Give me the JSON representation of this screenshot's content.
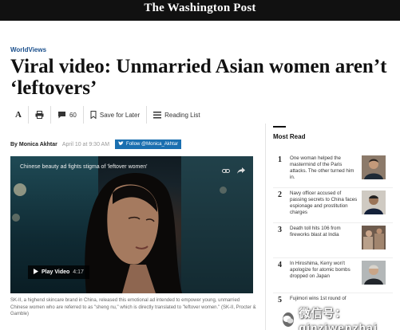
{
  "header": {
    "masthead": "The Washington Post",
    "bar_color": "#111111"
  },
  "article": {
    "section": "WorldViews",
    "headline": "Viral video: Unmarried Asian women aren’t ‘leftovers’",
    "toolbar": {
      "font_label": "A",
      "comments_count": "60",
      "save_label": "Save for Later",
      "reading_list_label": "Reading List"
    },
    "byline": {
      "author": "By Monica Akhtar",
      "date": "April 10 at 9:30 AM",
      "follow_label": "Follow @Monica_Akhtar",
      "follow_color": "#1a6fb0"
    },
    "video": {
      "title": "Chinese beauty ad fights stigma of 'leftover women'",
      "play_label": "Play Video",
      "duration": "4:17"
    },
    "caption": "SK-II, a highend skincare brand in China, released this emotional ad intended to empower young, unmarried Chinese women who are referred to as \"sheng nu,\" which is directly translated to \"leftover women.\" (SK-II, Procter & Gamble)"
  },
  "most_read": {
    "title": "Most Read",
    "items": [
      {
        "number": "1",
        "text": "One woman helped the mastermind of the Paris attacks. The other turned him in."
      },
      {
        "number": "2",
        "text": "Navy officer accused of passing secrets to China faces espionage and prostitution charges"
      },
      {
        "number": "3",
        "text": "Death toll hits 106 from fireworks blast at India"
      },
      {
        "number": "4",
        "text": "In Hiroshima, Kerry won't apologize for atomic bombs dropped on Japan"
      },
      {
        "number": "5",
        "text": "Fujimori wins 1st round of"
      }
    ]
  },
  "watermark": {
    "text": "微信号：qinziwenzhai"
  }
}
